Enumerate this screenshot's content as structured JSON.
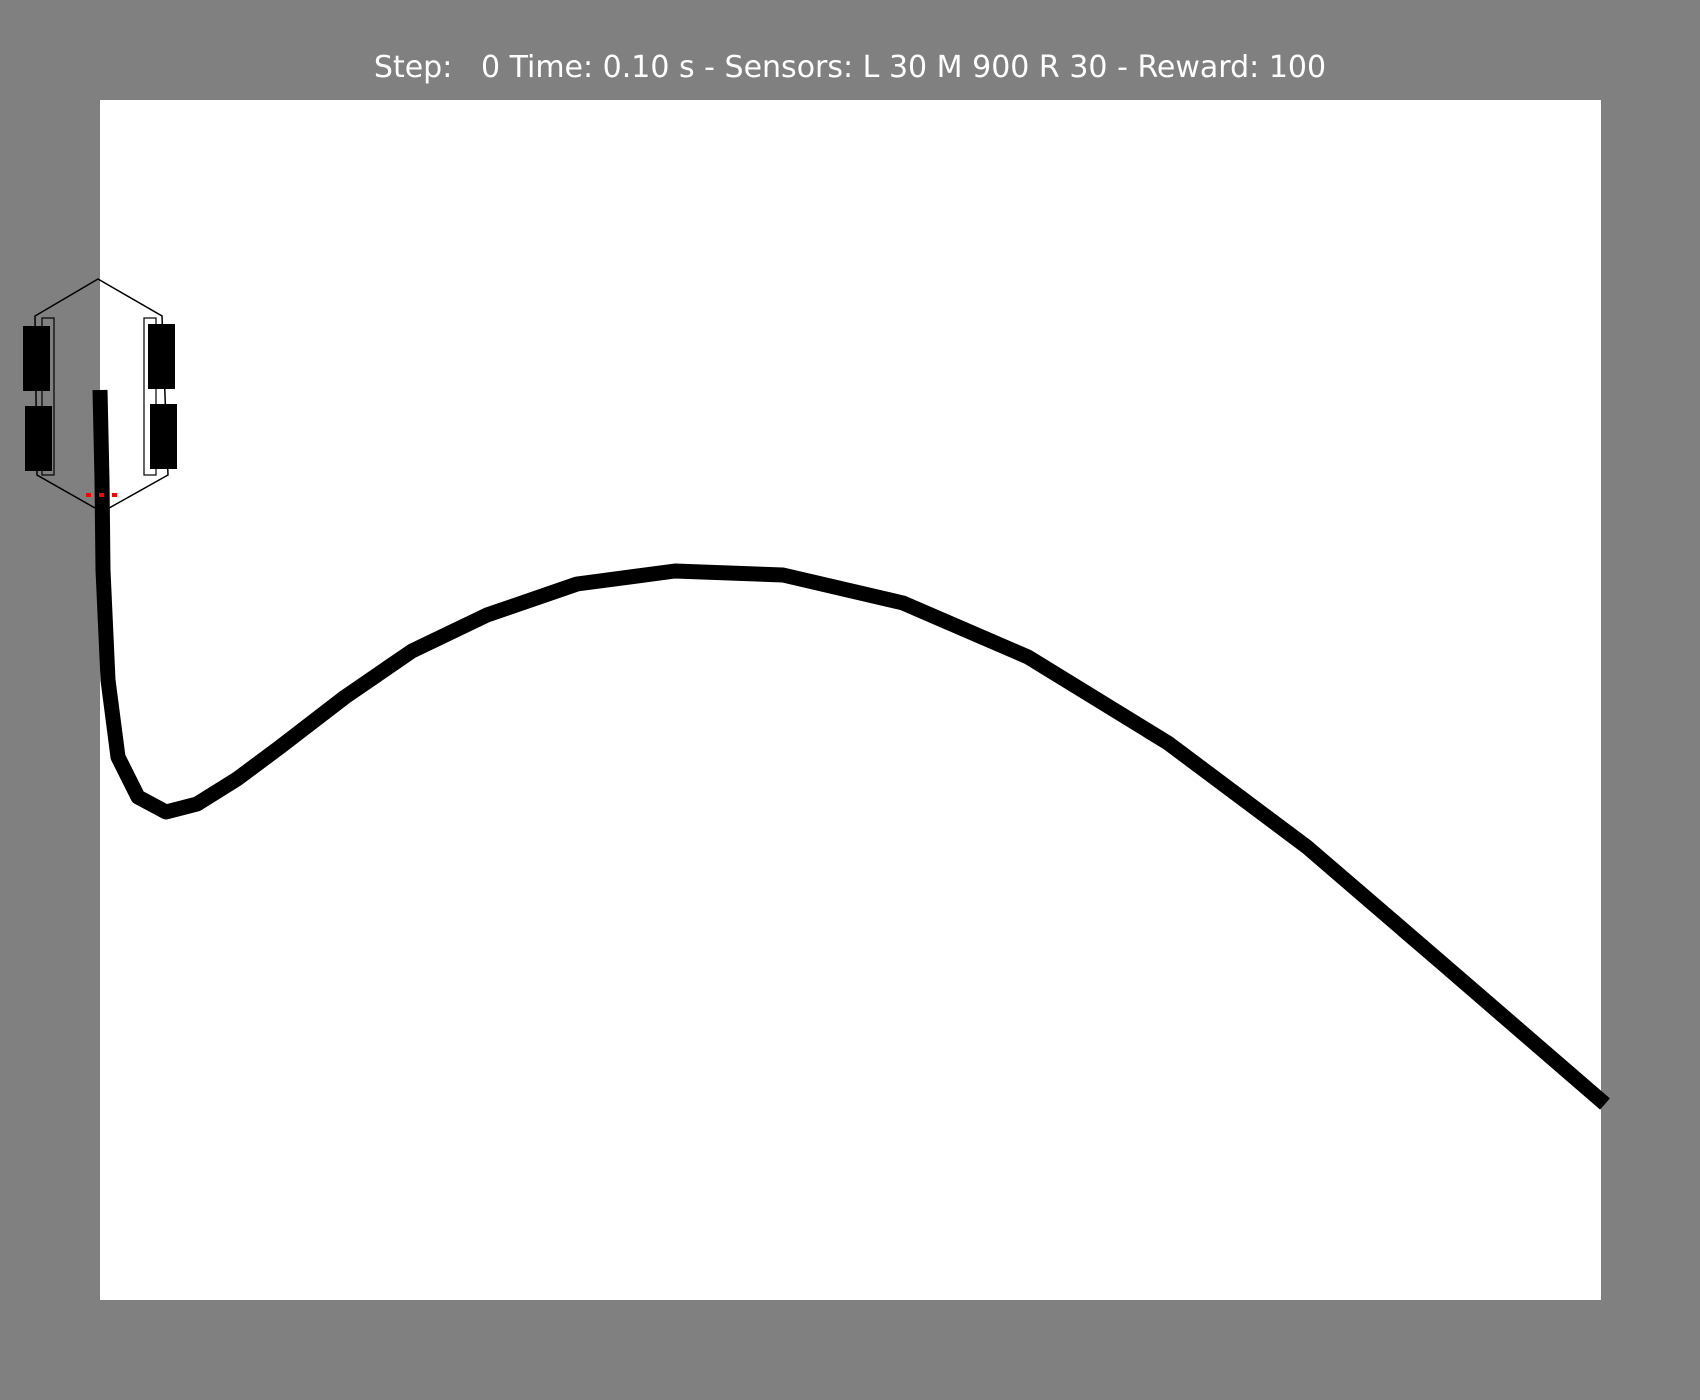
{
  "status": {
    "step_label": "Step:",
    "step_value": "0",
    "time_label": "Time:",
    "time_value": "0.10 s",
    "separator": "-",
    "sensors_label": "Sensors:",
    "sensor_left_label": "L",
    "sensor_left_value": "30",
    "sensor_middle_label": "M",
    "sensor_middle_value": "900",
    "sensor_right_label": "R",
    "sensor_right_value": "30",
    "reward_label": "Reward:",
    "reward_value": "100"
  },
  "colors": {
    "background": "#808080",
    "field": "#ffffff",
    "track": "#000000",
    "robot_outline": "#000000",
    "wheels": "#000000",
    "sensors": "#ff0000",
    "status_text": "#ffffff"
  },
  "robot": {
    "icon": "line-follower-robot-icon",
    "wheel_count": 4,
    "sensor_count": 3
  }
}
